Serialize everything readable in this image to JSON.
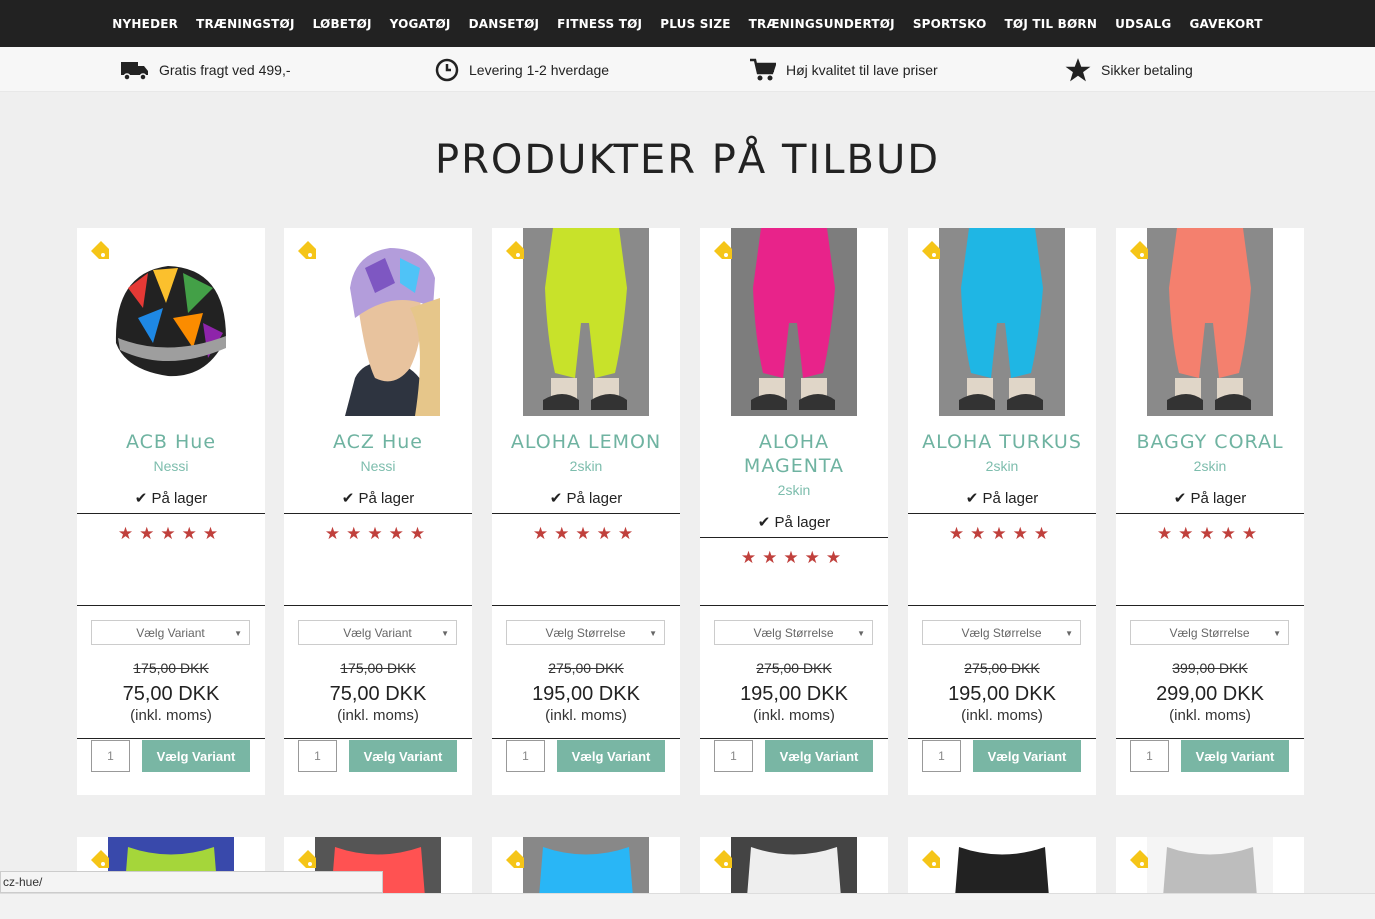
{
  "nav": [
    "NYHEDER",
    "TRÆNINGSTØJ",
    "LØBETØJ",
    "YOGATØJ",
    "DANSETØJ",
    "FITNESS TØJ",
    "PLUS SIZE",
    "TRÆNINGSUNDERTØJ",
    "SPORTSKO",
    "TØJ TIL BØRN",
    "UDSALG",
    "GAVEKORT"
  ],
  "usp": [
    {
      "icon": "truck-icon",
      "text": "Gratis fragt ved 499,-"
    },
    {
      "icon": "clock-icon",
      "text": "Levering 1-2 hverdage"
    },
    {
      "icon": "cart-icon",
      "text": "Høj kvalitet til lave priser"
    },
    {
      "icon": "star-icon",
      "text": "Sikker betaling"
    }
  ],
  "page_title": "PRODUKTER PÅ TILBUD",
  "products": [
    {
      "name": "ACB Hue",
      "brand": "Nessi",
      "stock": "På lager",
      "select": "Vælg Variant",
      "old_price": "175,00 DKK",
      "price": "75,00 DKK",
      "vat": "(inkl. moms)",
      "qty": "1",
      "button": "Vælg Variant",
      "rating": 5
    },
    {
      "name": "ACZ Hue",
      "brand": "Nessi",
      "stock": "På lager",
      "select": "Vælg Variant",
      "old_price": "175,00 DKK",
      "price": "75,00 DKK",
      "vat": "(inkl. moms)",
      "qty": "1",
      "button": "Vælg Variant",
      "rating": 5
    },
    {
      "name": "ALOHA LEMON",
      "brand": "2skin",
      "stock": "På lager",
      "select": "Vælg Størrelse",
      "old_price": "275,00 DKK",
      "price": "195,00 DKK",
      "vat": "(inkl. moms)",
      "qty": "1",
      "button": "Vælg Variant",
      "rating": 5
    },
    {
      "name": "ALOHA MAGENTA",
      "brand": "2skin",
      "stock": "På lager",
      "select": "Vælg Størrelse",
      "old_price": "275,00 DKK",
      "price": "195,00 DKK",
      "vat": "(inkl. moms)",
      "qty": "1",
      "button": "Vælg Variant",
      "rating": 5
    },
    {
      "name": "ALOHA TURKUS",
      "brand": "2skin",
      "stock": "På lager",
      "select": "Vælg Størrelse",
      "old_price": "275,00 DKK",
      "price": "195,00 DKK",
      "vat": "(inkl. moms)",
      "qty": "1",
      "button": "Vælg Variant",
      "rating": 5
    },
    {
      "name": "BAGGY CORAL",
      "brand": "2skin",
      "stock": "På lager",
      "select": "Vælg Størrelse",
      "old_price": "399,00 DKK",
      "price": "299,00 DKK",
      "vat": "(inkl. moms)",
      "qty": "1",
      "button": "Vælg Variant",
      "rating": 5
    }
  ],
  "status_url": "cz-hue/",
  "colors": {
    "accent": "#79b6a4",
    "name": "#6fb3a1",
    "star": "#c0403c",
    "tag": "#f5c518",
    "nav_bg": "#222222"
  }
}
